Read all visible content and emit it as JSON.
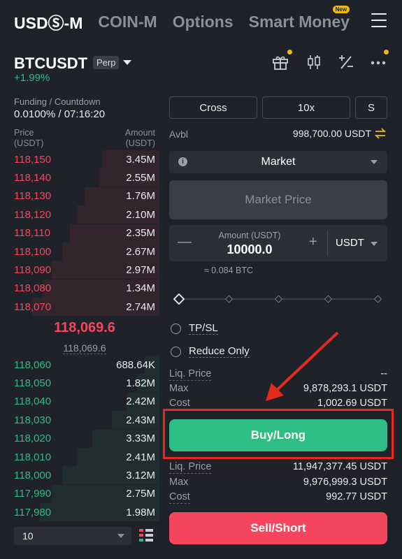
{
  "topnav": {
    "tabs": [
      {
        "label": "USDⓈ-M",
        "active": true
      },
      {
        "label": "COIN-M",
        "active": false
      },
      {
        "label": "Options",
        "active": false
      },
      {
        "label": "Smart Money",
        "active": false,
        "badge": "New"
      }
    ]
  },
  "header": {
    "symbol": "BTCUSDT",
    "badge": "Perp",
    "change": "+1.99%",
    "icons": [
      "gift-icon",
      "candlestick-icon",
      "calculator-icon",
      "more-icon"
    ]
  },
  "funding": {
    "label": "Funding / Countdown",
    "value": "0.0100% / 07:16:20"
  },
  "orderbook": {
    "price_header": [
      "Price",
      "(USDT)"
    ],
    "amount_header": [
      "Amount",
      "(USDT)"
    ],
    "asks": [
      {
        "price": "118,150",
        "amount": "3.45M",
        "depth": 0.38
      },
      {
        "price": "118,140",
        "amount": "2.55M",
        "depth": 0.4
      },
      {
        "price": "118,130",
        "amount": "1.76M",
        "depth": 0.5
      },
      {
        "price": "118,120",
        "amount": "2.10M",
        "depth": 0.55
      },
      {
        "price": "118,110",
        "amount": "2.35M",
        "depth": 0.6
      },
      {
        "price": "118,100",
        "amount": "2.67M",
        "depth": 0.65
      },
      {
        "price": "118,090",
        "amount": "2.97M",
        "depth": 0.72
      },
      {
        "price": "118,080",
        "amount": "1.34M",
        "depth": 0.78
      },
      {
        "price": "118,070",
        "amount": "2.74M",
        "depth": 0.85
      }
    ],
    "last_price": "118,069.6",
    "mark_price": "118,069.6",
    "bids": [
      {
        "price": "118,060",
        "amount": "688.64K",
        "depth": 0.1
      },
      {
        "price": "118,050",
        "amount": "1.82M",
        "depth": 0.15
      },
      {
        "price": "118,040",
        "amount": "2.42M",
        "depth": 0.22
      },
      {
        "price": "118,030",
        "amount": "2.43M",
        "depth": 0.32
      },
      {
        "price": "118,020",
        "amount": "3.33M",
        "depth": 0.45
      },
      {
        "price": "118,010",
        "amount": "2.41M",
        "depth": 0.55
      },
      {
        "price": "118,000",
        "amount": "3.12M",
        "depth": 0.65
      },
      {
        "price": "117,990",
        "amount": "2.75M",
        "depth": 0.72
      },
      {
        "price": "117,980",
        "amount": "1.98M",
        "depth": 0.8
      }
    ],
    "depth_select": "10"
  },
  "trade": {
    "margin_mode": "Cross",
    "leverage": "10x",
    "position_mode": "S",
    "avbl_label": "Avbl",
    "avbl_value": "998,700.00 USDT",
    "order_type": "Market",
    "price_placeholder": "Market Price",
    "amount_label": "Amount (USDT)",
    "amount_value": "10000.0",
    "amount_unit": "USDT",
    "amount_btc": "≈ 0.084 BTC",
    "slider_percent": 0,
    "tpsl_label": "TP/SL",
    "reduce_only_label": "Reduce Only",
    "buy_info": {
      "liq_label": "Liq. Price",
      "liq_value": "--",
      "max_label": "Max",
      "max_value": "9,878,293.1 USDT",
      "cost_label": "Cost",
      "cost_value": "1,002.69 USDT"
    },
    "buy_button": "Buy/Long",
    "sell_info": {
      "liq_label": "Liq. Price",
      "liq_value": "11,947,377.45 USDT",
      "max_label": "Max",
      "max_value": "9,976,999.3 USDT",
      "cost_label": "Cost",
      "cost_value": "992.77 USDT"
    },
    "sell_button": "Sell/Short"
  },
  "colors": {
    "bg": "#1f2228",
    "buy": "#2ebd85",
    "sell": "#f6465d",
    "accent": "#f0b90b",
    "annotation": "#e22b1c"
  }
}
